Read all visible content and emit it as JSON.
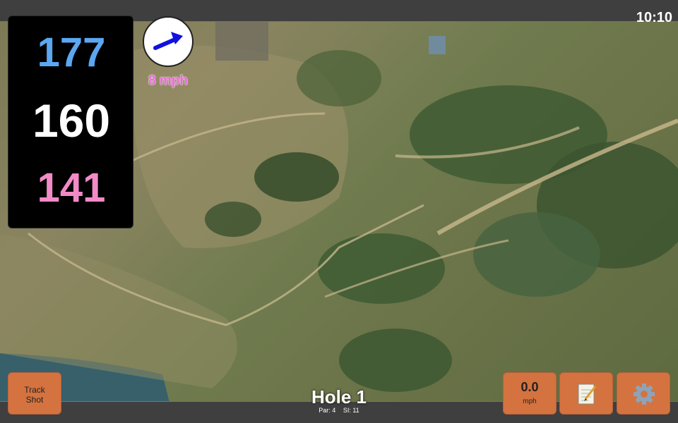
{
  "status": {
    "clock": "10:10"
  },
  "distances": {
    "back": "177",
    "center": "160",
    "front": "141"
  },
  "wind": {
    "speed_label": "8 mph",
    "direction_icon": "wind-arrow-icon",
    "arrow_color": "#1111dd"
  },
  "hole": {
    "title": "Hole 1",
    "par_label": "Par: 4",
    "si_label": "SI: 11"
  },
  "buttons": {
    "track_shot_label": "Track Shot",
    "wind_value": "0.0",
    "wind_unit": "mph",
    "notes_icon": "notepad-icon",
    "settings_icon": "gear-icon"
  },
  "colors": {
    "back_distance": "#5ba7f2",
    "center_distance": "#ffffff",
    "front_distance": "#f28ac8",
    "button": "#d4733f",
    "wind_text": "#ee66dd"
  }
}
